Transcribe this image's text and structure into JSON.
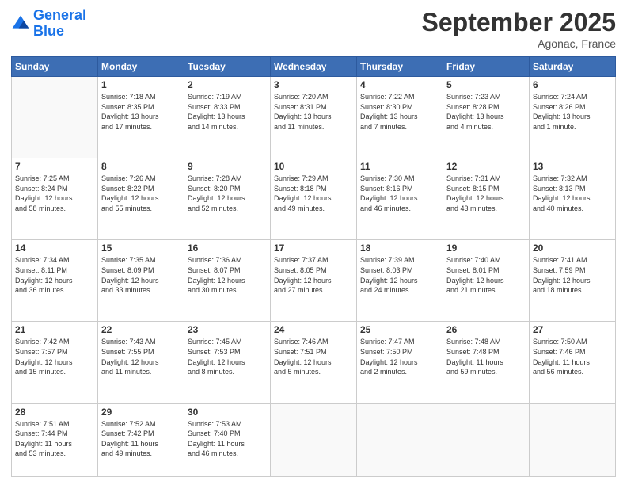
{
  "logo": {
    "line1": "General",
    "line2": "Blue"
  },
  "title": "September 2025",
  "subtitle": "Agonac, France",
  "days_of_week": [
    "Sunday",
    "Monday",
    "Tuesday",
    "Wednesday",
    "Thursday",
    "Friday",
    "Saturday"
  ],
  "weeks": [
    [
      {
        "num": "",
        "info": ""
      },
      {
        "num": "1",
        "info": "Sunrise: 7:18 AM\nSunset: 8:35 PM\nDaylight: 13 hours\nand 17 minutes."
      },
      {
        "num": "2",
        "info": "Sunrise: 7:19 AM\nSunset: 8:33 PM\nDaylight: 13 hours\nand 14 minutes."
      },
      {
        "num": "3",
        "info": "Sunrise: 7:20 AM\nSunset: 8:31 PM\nDaylight: 13 hours\nand 11 minutes."
      },
      {
        "num": "4",
        "info": "Sunrise: 7:22 AM\nSunset: 8:30 PM\nDaylight: 13 hours\nand 7 minutes."
      },
      {
        "num": "5",
        "info": "Sunrise: 7:23 AM\nSunset: 8:28 PM\nDaylight: 13 hours\nand 4 minutes."
      },
      {
        "num": "6",
        "info": "Sunrise: 7:24 AM\nSunset: 8:26 PM\nDaylight: 13 hours\nand 1 minute."
      }
    ],
    [
      {
        "num": "7",
        "info": "Sunrise: 7:25 AM\nSunset: 8:24 PM\nDaylight: 12 hours\nand 58 minutes."
      },
      {
        "num": "8",
        "info": "Sunrise: 7:26 AM\nSunset: 8:22 PM\nDaylight: 12 hours\nand 55 minutes."
      },
      {
        "num": "9",
        "info": "Sunrise: 7:28 AM\nSunset: 8:20 PM\nDaylight: 12 hours\nand 52 minutes."
      },
      {
        "num": "10",
        "info": "Sunrise: 7:29 AM\nSunset: 8:18 PM\nDaylight: 12 hours\nand 49 minutes."
      },
      {
        "num": "11",
        "info": "Sunrise: 7:30 AM\nSunset: 8:16 PM\nDaylight: 12 hours\nand 46 minutes."
      },
      {
        "num": "12",
        "info": "Sunrise: 7:31 AM\nSunset: 8:15 PM\nDaylight: 12 hours\nand 43 minutes."
      },
      {
        "num": "13",
        "info": "Sunrise: 7:32 AM\nSunset: 8:13 PM\nDaylight: 12 hours\nand 40 minutes."
      }
    ],
    [
      {
        "num": "14",
        "info": "Sunrise: 7:34 AM\nSunset: 8:11 PM\nDaylight: 12 hours\nand 36 minutes."
      },
      {
        "num": "15",
        "info": "Sunrise: 7:35 AM\nSunset: 8:09 PM\nDaylight: 12 hours\nand 33 minutes."
      },
      {
        "num": "16",
        "info": "Sunrise: 7:36 AM\nSunset: 8:07 PM\nDaylight: 12 hours\nand 30 minutes."
      },
      {
        "num": "17",
        "info": "Sunrise: 7:37 AM\nSunset: 8:05 PM\nDaylight: 12 hours\nand 27 minutes."
      },
      {
        "num": "18",
        "info": "Sunrise: 7:39 AM\nSunset: 8:03 PM\nDaylight: 12 hours\nand 24 minutes."
      },
      {
        "num": "19",
        "info": "Sunrise: 7:40 AM\nSunset: 8:01 PM\nDaylight: 12 hours\nand 21 minutes."
      },
      {
        "num": "20",
        "info": "Sunrise: 7:41 AM\nSunset: 7:59 PM\nDaylight: 12 hours\nand 18 minutes."
      }
    ],
    [
      {
        "num": "21",
        "info": "Sunrise: 7:42 AM\nSunset: 7:57 PM\nDaylight: 12 hours\nand 15 minutes."
      },
      {
        "num": "22",
        "info": "Sunrise: 7:43 AM\nSunset: 7:55 PM\nDaylight: 12 hours\nand 11 minutes."
      },
      {
        "num": "23",
        "info": "Sunrise: 7:45 AM\nSunset: 7:53 PM\nDaylight: 12 hours\nand 8 minutes."
      },
      {
        "num": "24",
        "info": "Sunrise: 7:46 AM\nSunset: 7:51 PM\nDaylight: 12 hours\nand 5 minutes."
      },
      {
        "num": "25",
        "info": "Sunrise: 7:47 AM\nSunset: 7:50 PM\nDaylight: 12 hours\nand 2 minutes."
      },
      {
        "num": "26",
        "info": "Sunrise: 7:48 AM\nSunset: 7:48 PM\nDaylight: 11 hours\nand 59 minutes."
      },
      {
        "num": "27",
        "info": "Sunrise: 7:50 AM\nSunset: 7:46 PM\nDaylight: 11 hours\nand 56 minutes."
      }
    ],
    [
      {
        "num": "28",
        "info": "Sunrise: 7:51 AM\nSunset: 7:44 PM\nDaylight: 11 hours\nand 53 minutes."
      },
      {
        "num": "29",
        "info": "Sunrise: 7:52 AM\nSunset: 7:42 PM\nDaylight: 11 hours\nand 49 minutes."
      },
      {
        "num": "30",
        "info": "Sunrise: 7:53 AM\nSunset: 7:40 PM\nDaylight: 11 hours\nand 46 minutes."
      },
      {
        "num": "",
        "info": ""
      },
      {
        "num": "",
        "info": ""
      },
      {
        "num": "",
        "info": ""
      },
      {
        "num": "",
        "info": ""
      }
    ]
  ]
}
